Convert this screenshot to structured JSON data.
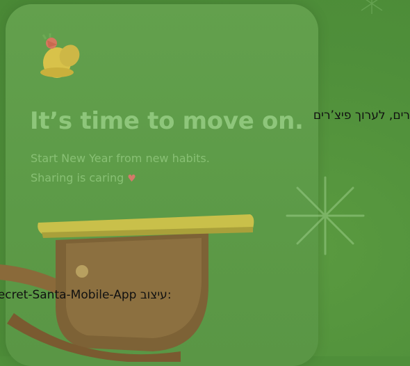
{
  "screen": {
    "title": "It’s time to move on.",
    "subtitle_line1": "Start New Year from new habits.",
    "subtitle_line2": "Sharing is caring",
    "heart_glyph": "♥"
  },
  "overlay": {
    "line1": "רים, לערוך פיצ’רים",
    "line2_prefix": "עיצוב:",
    "line2_name": "Secret-Santa-Mobile-App"
  },
  "icons": [
    "bell-icon",
    "star-sparkle-icon",
    "heart-icon",
    "sled-illustration"
  ],
  "colors": {
    "background": "#4f8f3a",
    "card": "#5f9c49",
    "accent_text": "#8ec67b",
    "overlay_text": "#111111"
  }
}
